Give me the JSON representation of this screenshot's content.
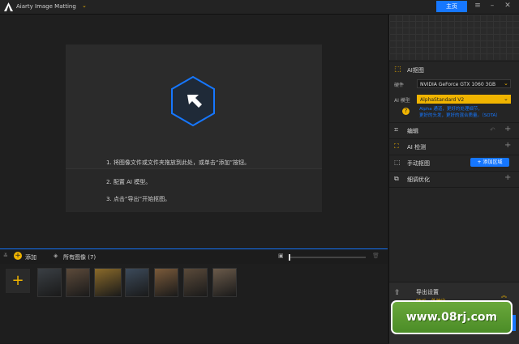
{
  "app": {
    "title": "Aiarty Image Matting",
    "home_label": "主页"
  },
  "dropzone": {
    "steps": [
      "1. 将图像文件或文件夹拖放到此处，或单击“添加”按钮。",
      "2. 配置 AI 模型。",
      "3. 点击“导出”开始抠图。"
    ]
  },
  "strip": {
    "add_label": "添加",
    "all_images_label": "所有图像 (7)",
    "thumb_colors": [
      "#3a3f44",
      "#5c4a3a",
      "#8a6a2a",
      "#3c4a5a",
      "#7a5a3a",
      "#5a4a3a",
      "#6a5a4a"
    ]
  },
  "panel": {
    "ai_matting": {
      "title": "AI抠图",
      "hardware_label": "硬件",
      "hardware_value": "NVIDIA GeForce GTX 1060 3GB",
      "model_label": "AI 模型",
      "model_value": "AlphaStandard  V2",
      "note_line1": "Alpha 通道，更好的处理细节，",
      "note_line2": "更好的头发，更好的混合质量。（SOTA）"
    },
    "edit": {
      "title": "编辑"
    },
    "ai_detect": {
      "title": "AI 检测"
    },
    "manual": {
      "title": "手动抠图",
      "add_region": "+ 添加区域"
    },
    "refine": {
      "title": "细调优化"
    },
    "export": {
      "title": "导出设置",
      "sub": "PNG，外抽出"
    }
  },
  "watermark": {
    "text": "www.08rj.com"
  },
  "colors": {
    "accent": "#1677ff",
    "warning": "#f0b400"
  }
}
